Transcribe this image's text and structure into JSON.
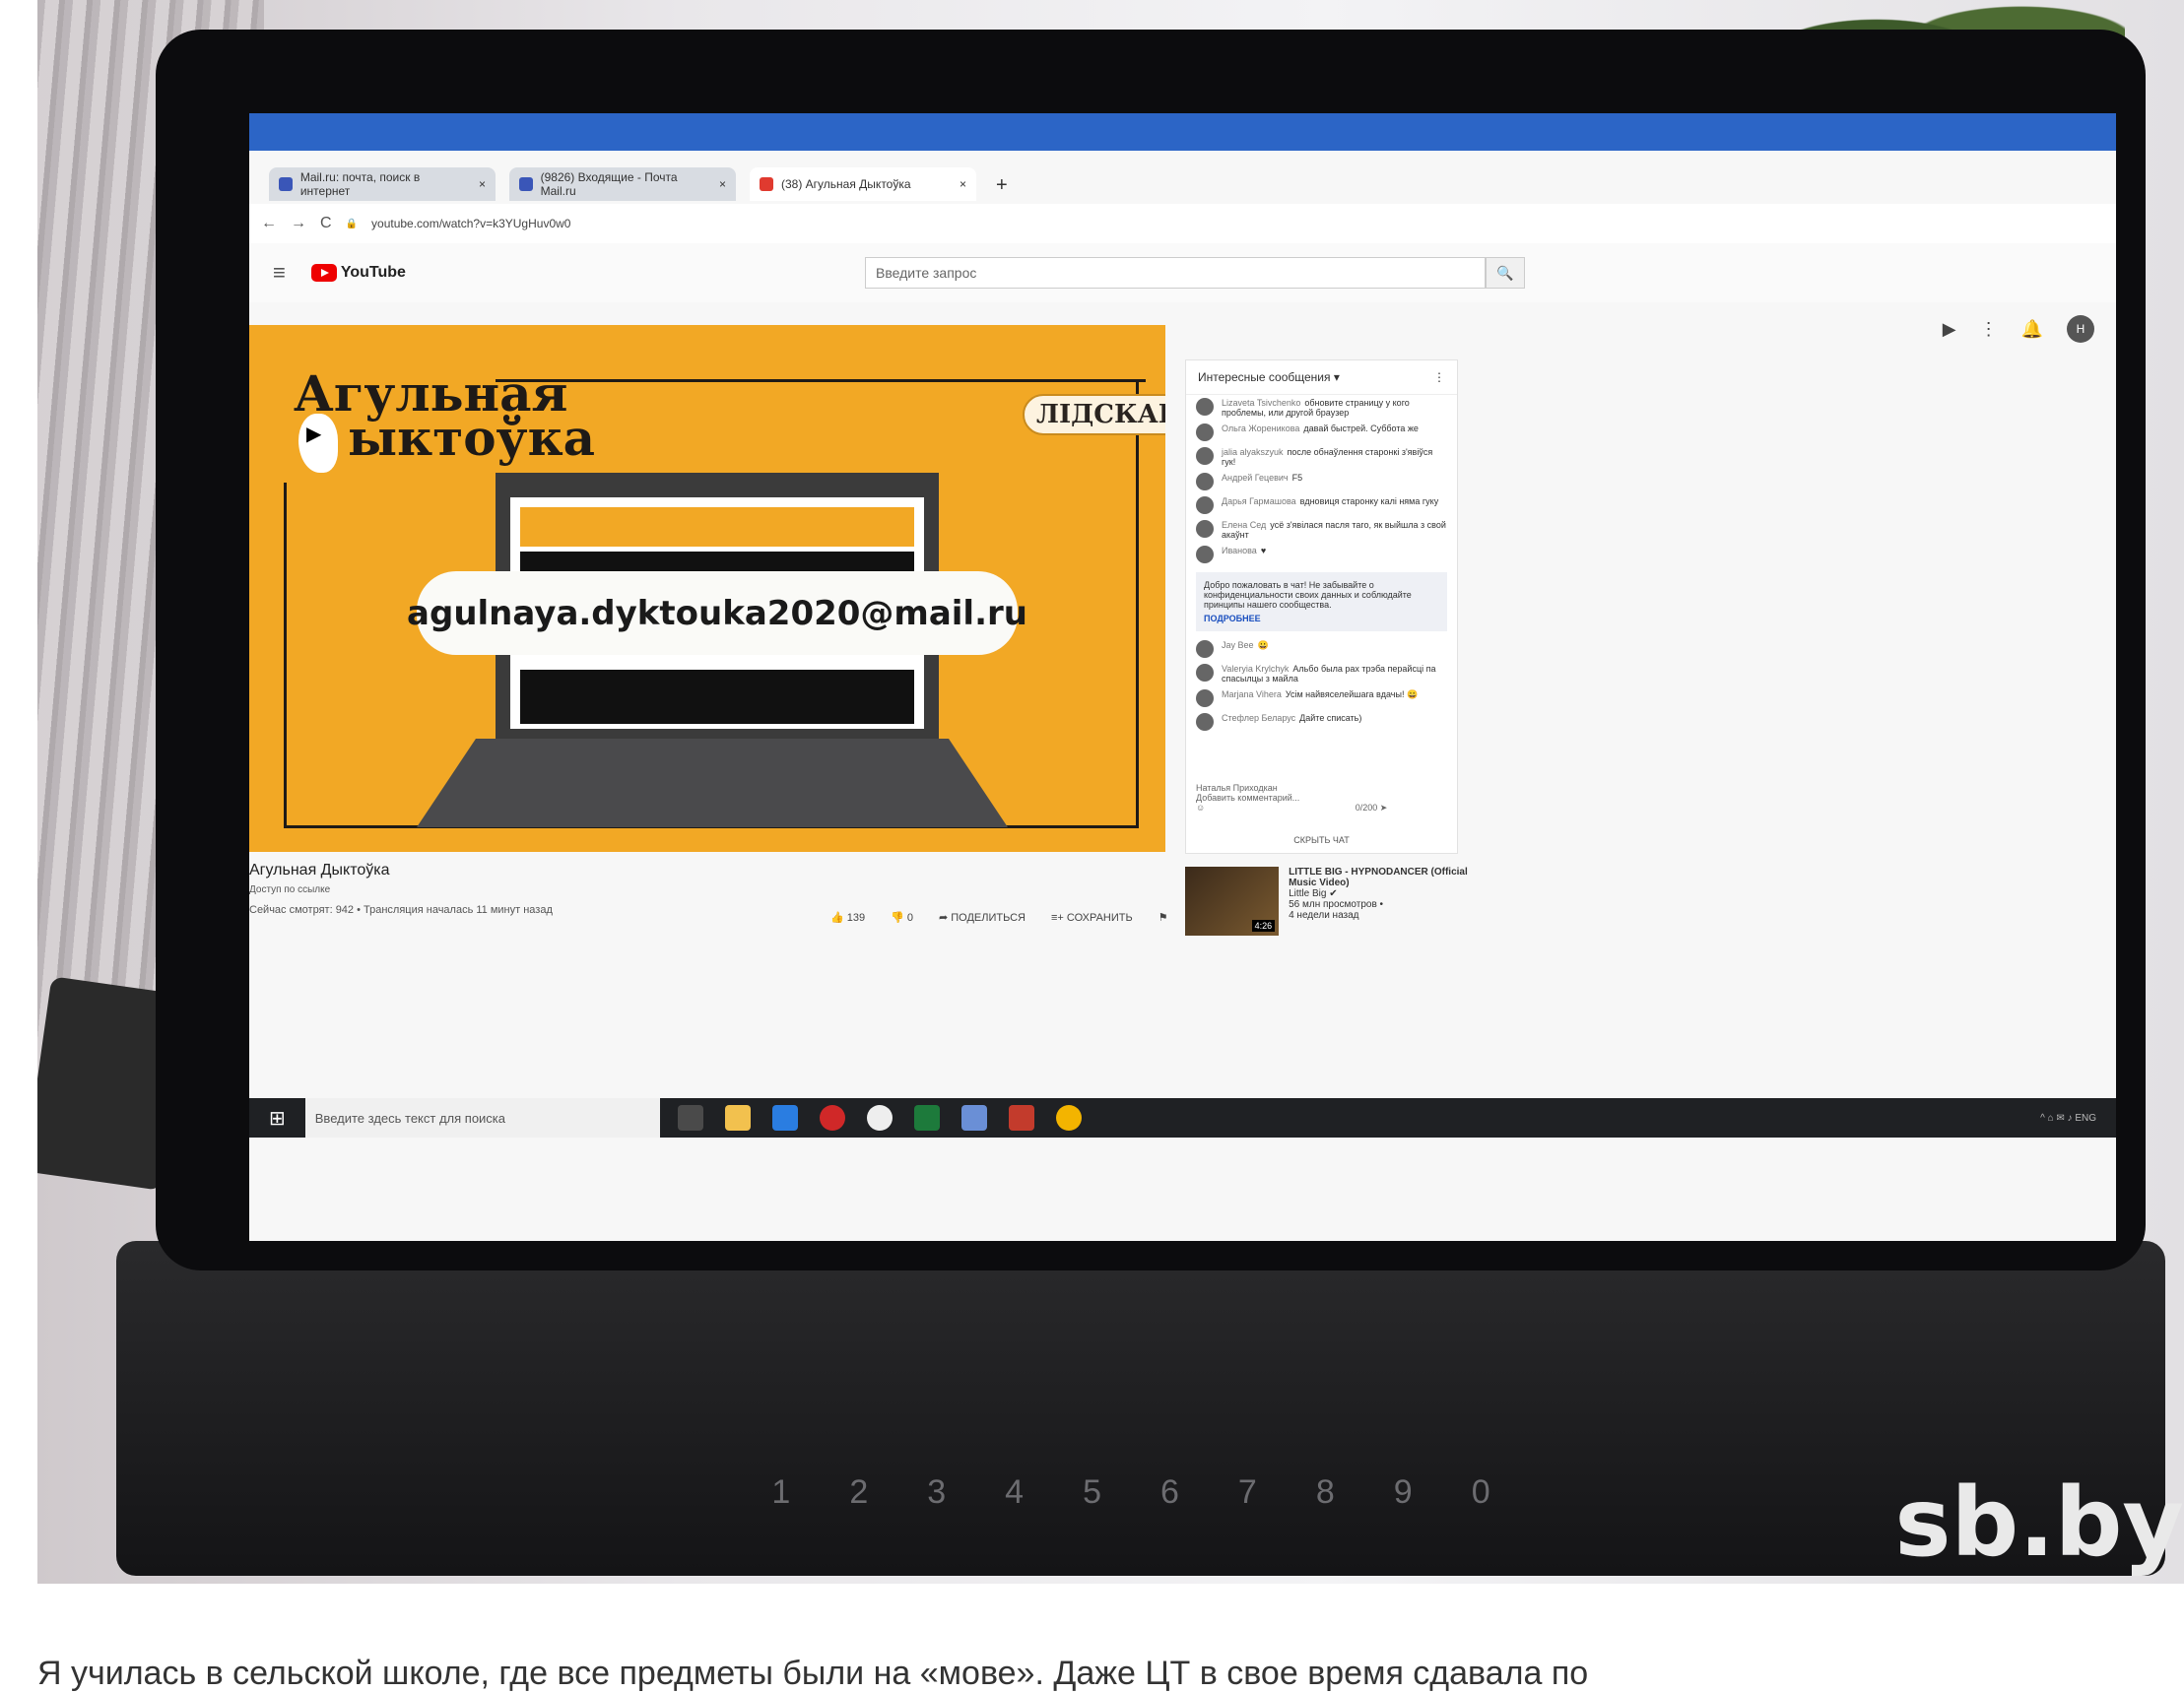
{
  "browser": {
    "tabs": [
      {
        "label": "Mail.ru: почта, поиск в интернет",
        "close": "×"
      },
      {
        "label": "(9826) Входящие - Почта Mail.ru",
        "close": "×"
      },
      {
        "label": "(38) Агульная Дыктоўка",
        "close": "×"
      }
    ],
    "new_tab": "+",
    "url": "youtube.com/watch?v=k3YUgHuv0w0",
    "back": "←",
    "forward": "→",
    "reload": "C",
    "lock": "🔒"
  },
  "youtube": {
    "logo_text": "YouTube",
    "menu": "≡",
    "search_placeholder": "Введите запрос",
    "search_icon": "🔍",
    "create_icon": "▶",
    "apps_icon": "⋮",
    "notify_icon": "🔔",
    "avatar": "Н"
  },
  "video": {
    "title_line1": "Агульная",
    "title_line2": "ыктоўка",
    "badge": "ЛІДСКАЕ",
    "email": "agulnaya.dyktouka2020@mail.ru"
  },
  "below_video": {
    "title": "Агульная Дыктоўка",
    "subtitle": "Доступ по ссылке",
    "viewers": "Сейчас смотрят: 942 • Трансляция началась 11 минут назад"
  },
  "actions": {
    "like": "👍 139",
    "dislike": "👎 0",
    "share": "➦ ПОДЕЛИТЬСЯ",
    "save": "≡+ СОХРАНИТЬ",
    "flag": "⚑",
    "more": "⋯"
  },
  "chat": {
    "header": "Интересные сообщения ▾",
    "menu": "⋮",
    "messages": [
      {
        "name": "Lizaveta Tsivchenko",
        "text": "обновите страницу у кого проблемы, или другой браузер"
      },
      {
        "name": "Ольга Жореникова",
        "text": "давай быстрей. Суббота же"
      },
      {
        "name": "jalia alyakszyuk",
        "text": "после обнаўлення старонкі з'явіўся гук!"
      },
      {
        "name": "Андрей Гецевич",
        "text": "F5"
      },
      {
        "name": "Дарья Гармашова",
        "text": "вдновиця старонку калі няма гуку"
      },
      {
        "name": "Елена Сед",
        "text": "усё з'явілася пасля таго, як выйшла з свой акаўнт"
      },
      {
        "name": "Иванова",
        "text": "♥"
      }
    ],
    "notice": "Добро пожаловать в чат! Не забывайте о конфиденциальности своих данных и соблюдайте принципы нашего сообщества.",
    "notice_more": "ПОДРОБНЕЕ",
    "messages2": [
      {
        "name": "Jay Bee",
        "text": "😀"
      },
      {
        "name": "Valeryia Krylchyk",
        "text": "Альбо была рах трэба перайсці па спасылцы з майла"
      },
      {
        "name": "Marjana Vihera",
        "text": "Усім найвяселейшага вдачы! 😀"
      },
      {
        "name": "Стефлер Беларус",
        "text": "Дайте списать)"
      }
    ],
    "input_name": "Наталья Приходкан",
    "input_placeholder": "Добавить комментарий...",
    "counter": "0/200",
    "send": "➤",
    "emoji": "☺",
    "hide": "СКРЫТЬ ЧАТ"
  },
  "recommendation": {
    "title": "LITTLE BIG - HYPNODANCER (Official Music Video)",
    "channel": "Little Big ✔",
    "views": "56 млн просмотров •",
    "age": "4 недели назад",
    "duration": "4:26"
  },
  "taskbar": {
    "start": "⊞",
    "search": "Введите здесь текст для поиска",
    "tray": "^ ⌂ ✉ ♪ ENG"
  },
  "watermark": "sb.by",
  "keyboard_digits": [
    "`",
    "1",
    "2",
    "3",
    "4",
    "5",
    "6",
    "7",
    "8",
    "9",
    "0"
  ],
  "caption": "Я училась в сельской школе, где все предметы были на «мове». Даже ЦТ в свое время сдавала по"
}
